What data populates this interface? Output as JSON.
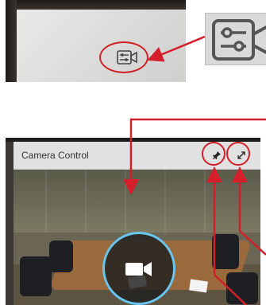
{
  "panel": {
    "title": "Camera Control"
  },
  "icons": {
    "camera_settings": "camera-settings-icon",
    "pin": "pin-icon",
    "expand": "expand-icon",
    "camera": "video-camera-icon"
  },
  "colors": {
    "annotation": "#d21f2b",
    "camera_ring": "#69c4ee"
  }
}
